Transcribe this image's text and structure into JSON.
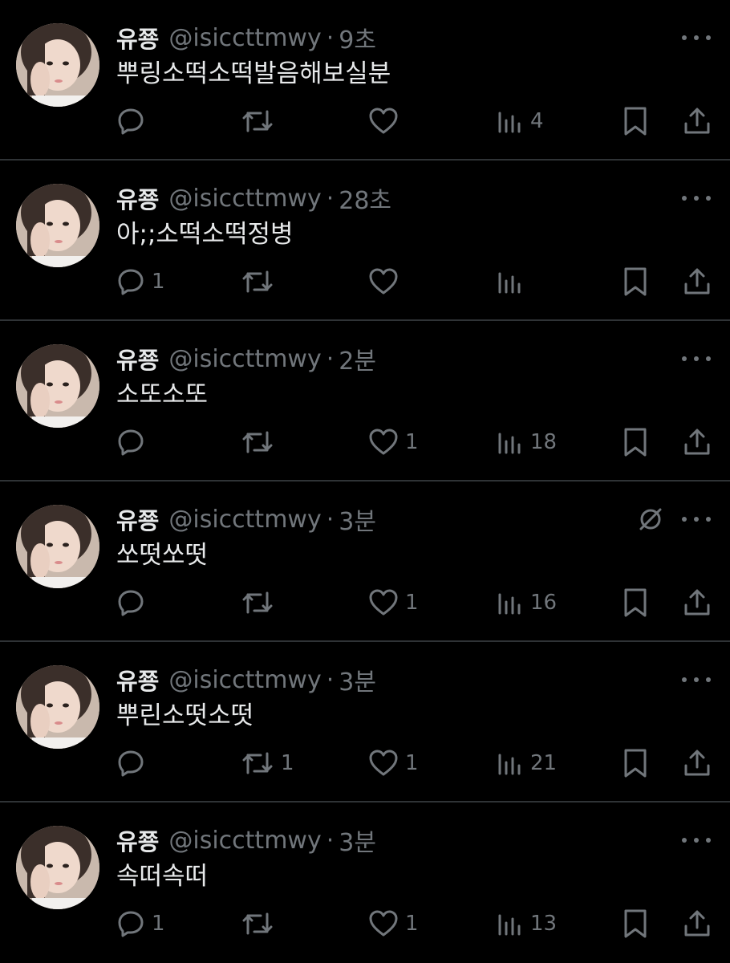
{
  "colors": {
    "background": "#000000",
    "text_primary": "#e7e9ea",
    "text_secondary": "#71767b",
    "divider": "#2f3336"
  },
  "tweets": [
    {
      "name": "유쭁",
      "handle": "@isiccttmwy",
      "separator": "·",
      "time": "9초",
      "text": "뿌링소떡소떡발음해보실분",
      "muted": false,
      "replies": "",
      "retweets": "",
      "likes": "",
      "views": "4"
    },
    {
      "name": "유쭁",
      "handle": "@isiccttmwy",
      "separator": "·",
      "time": "28초",
      "text": "아;;소떡소떡정병",
      "muted": false,
      "replies": "1",
      "retweets": "",
      "likes": "",
      "views": ""
    },
    {
      "name": "유쭁",
      "handle": "@isiccttmwy",
      "separator": "·",
      "time": "2분",
      "text": "소또소또",
      "muted": false,
      "replies": "",
      "retweets": "",
      "likes": "1",
      "views": "18"
    },
    {
      "name": "유쭁",
      "handle": "@isiccttmwy",
      "separator": "·",
      "time": "3분",
      "text": "쏘떳쏘떳",
      "muted": true,
      "replies": "",
      "retweets": "",
      "likes": "1",
      "views": "16"
    },
    {
      "name": "유쭁",
      "handle": "@isiccttmwy",
      "separator": "·",
      "time": "3분",
      "text": "뿌린소떳소떳",
      "muted": false,
      "replies": "",
      "retweets": "1",
      "likes": "1",
      "views": "21"
    },
    {
      "name": "유쭁",
      "handle": "@isiccttmwy",
      "separator": "·",
      "time": "3분",
      "text": "속떠속떠",
      "muted": false,
      "replies": "1",
      "retweets": "",
      "likes": "1",
      "views": "13"
    }
  ],
  "icons": {
    "avatar": "avatar-photo",
    "more": "more-dots-icon",
    "muted": "muted-conversation-icon",
    "reply": "reply-bubble-icon",
    "retweet": "retweet-icon",
    "like": "heart-icon",
    "views": "views-bars-icon",
    "bookmark": "bookmark-icon",
    "share": "share-upload-icon"
  }
}
